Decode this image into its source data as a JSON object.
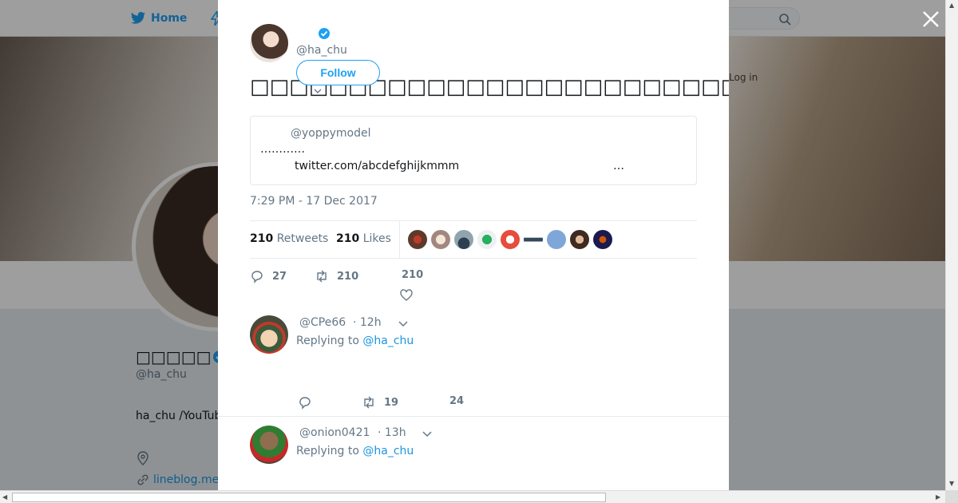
{
  "topbar": {
    "home_label": "Home",
    "login_hint": "Log in"
  },
  "profile": {
    "name": "□□□□□",
    "handle": "@ha_chu",
    "bio": "ha_chu /YouTub",
    "link": "lineblog.me"
  },
  "tweet": {
    "author_handle": "@ha_chu",
    "follow_label": "Follow",
    "text": "□□□□□□□□□□□□□□□□□□□□□□□□□□□□□□□□□□□□□□□□□□□□□□□□□□□□□□",
    "quote": {
      "handle": "@yoppymodel",
      "dots": "…………",
      "link": "twitter.com/abcdefghijkmmm",
      "ellipsis": "…"
    },
    "timestamp": "7:29 PM - 17 Dec 2017",
    "retweets_count": "210",
    "retweets_label": "Retweets",
    "likes_count": "210",
    "likes_label": "Likes",
    "actions": {
      "replies": "27",
      "retweets": "210",
      "likes": "210"
    }
  },
  "replies": [
    {
      "handle": "@CPe66",
      "time": "· 12h",
      "replying_prefix": "Replying to",
      "replying_to": "@ha_chu",
      "retweets": "19",
      "likes": "24"
    },
    {
      "handle": "@onion0421",
      "time": "· 13h",
      "replying_prefix": "Replying to",
      "replying_to": "@ha_chu"
    }
  ],
  "colors": {
    "accent": "#1da1f2",
    "link": "#1b95e0",
    "muted": "#657786",
    "text": "#14171a"
  },
  "icons": [
    "twitter-bird-icon",
    "lightning-icon",
    "search-icon",
    "close-icon",
    "verified-icon",
    "reply-icon",
    "retweet-icon",
    "heart-icon",
    "chevron-down-icon",
    "location-icon",
    "link-icon"
  ]
}
